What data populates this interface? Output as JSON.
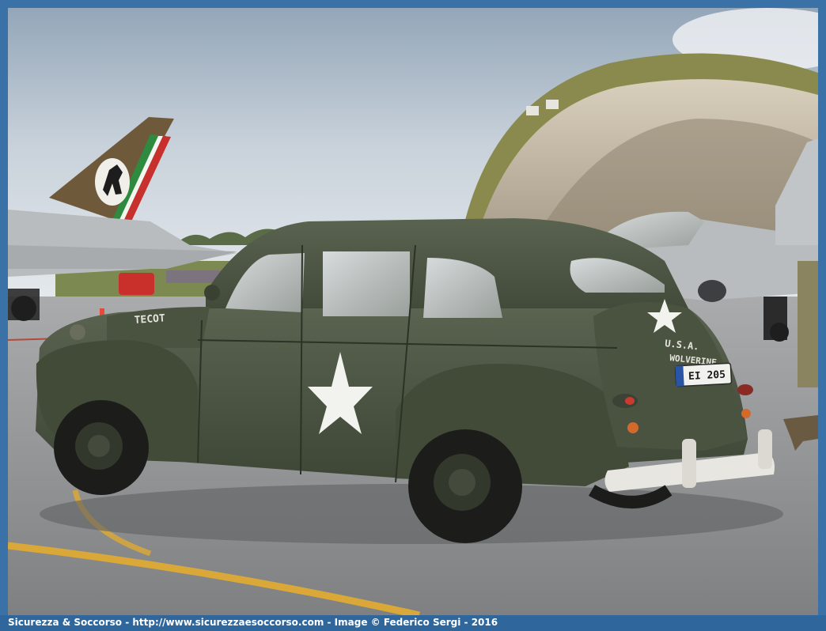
{
  "photo": {
    "description_scene": "vintage-army-staff-car-on-airfield",
    "colors": {
      "sky_top": "#8fa3b6",
      "sky_bottom": "#e4e9ee",
      "tarmac": "#8c8d8e",
      "car_olive": "#4b5440",
      "car_olive_dark": "#353c2e",
      "star": "#f2f2ee",
      "bumper": "#e8e6e0",
      "hangar_rim": "#8a8a4e",
      "hangar_inside": "#c8bda8",
      "jet_grey": "#b9bcbf",
      "yellow_line": "#d9a838",
      "frame_blue": "#3a72a8"
    },
    "car": {
      "hood_text": "TECOT",
      "trunk_text_line1": "U.S.A.",
      "trunk_text_line2": "WOLVERINE",
      "plate_text": "EI 205"
    }
  },
  "caption": {
    "text": "Sicurezza & Soccorso - http://www.sicurezzaesoccorso.com - Image © Federico Sergi - 2016"
  }
}
